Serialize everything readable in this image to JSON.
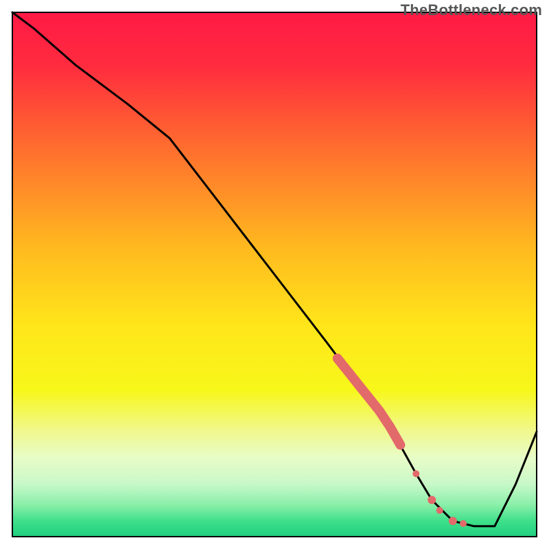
{
  "watermark": "TheBottleneck.com",
  "chart_data": {
    "type": "line",
    "title": "",
    "xlabel": "",
    "ylabel": "",
    "xlim": [
      0,
      100
    ],
    "ylim": [
      0,
      100
    ],
    "gradient_stops": [
      {
        "offset": 0.0,
        "color": "#ff1a45"
      },
      {
        "offset": 0.1,
        "color": "#ff2b3f"
      },
      {
        "offset": 0.25,
        "color": "#ff6a2f"
      },
      {
        "offset": 0.45,
        "color": "#ffba1f"
      },
      {
        "offset": 0.6,
        "color": "#ffe61a"
      },
      {
        "offset": 0.72,
        "color": "#f7f71a"
      },
      {
        "offset": 0.8,
        "color": "#f0f88f"
      },
      {
        "offset": 0.85,
        "color": "#e8fcc8"
      },
      {
        "offset": 0.9,
        "color": "#c8f8c8"
      },
      {
        "offset": 0.94,
        "color": "#88efa8"
      },
      {
        "offset": 0.97,
        "color": "#3fe08a"
      },
      {
        "offset": 1.0,
        "color": "#1fd080"
      }
    ],
    "line": {
      "x": [
        0.0,
        4.0,
        12.0,
        22.0,
        30.0,
        40.0,
        50.0,
        60.0,
        66.0,
        72.0,
        77.0,
        80.0,
        84.0,
        88.0,
        92.0,
        96.0,
        100.0
      ],
      "y": [
        100.0,
        97.0,
        90.0,
        82.5,
        76.0,
        63.0,
        50.0,
        37.0,
        29.0,
        21.0,
        12.0,
        7.0,
        3.0,
        2.0,
        2.0,
        10.0,
        20.0
      ]
    },
    "marker_segment": {
      "color": "#e36a6a",
      "thick": {
        "x": [
          62.0,
          64.0,
          66.0,
          68.0,
          70.0,
          72.0,
          74.0
        ],
        "y": [
          34.0,
          31.5,
          29.0,
          26.5,
          24.0,
          21.0,
          17.5
        ]
      },
      "dots": [
        {
          "x": 77.0,
          "y": 12.0,
          "r": 5
        },
        {
          "x": 80.0,
          "y": 7.0,
          "r": 6
        },
        {
          "x": 81.5,
          "y": 5.0,
          "r": 5
        },
        {
          "x": 84.0,
          "y": 3.0,
          "r": 6
        },
        {
          "x": 86.0,
          "y": 2.5,
          "r": 5
        }
      ]
    },
    "frame": {
      "stroke": "#000000",
      "width": 2
    }
  }
}
